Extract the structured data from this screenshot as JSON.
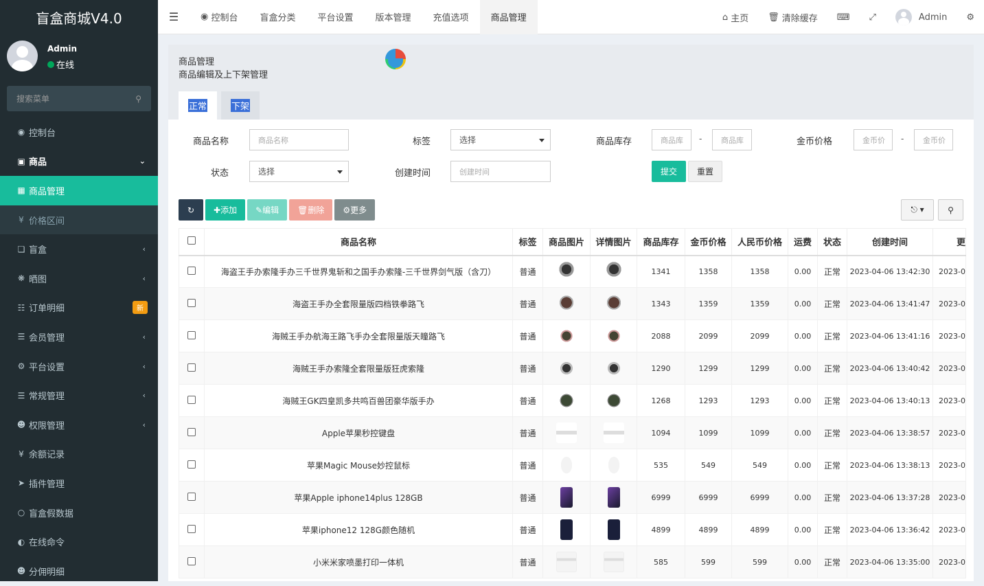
{
  "app": {
    "title": "盲盒商城V4.0"
  },
  "user": {
    "name": "Admin",
    "status": "在线"
  },
  "search": {
    "placeholder": "搜索菜单"
  },
  "menu": [
    {
      "label": "控制台",
      "icon": "dashboard-icon"
    },
    {
      "label": "商品",
      "icon": "shopping-bag-icon"
    },
    {
      "label": "商品管理",
      "icon": "shop-icon"
    },
    {
      "label": "价格区间",
      "icon": "yen-icon"
    },
    {
      "label": "盲盒",
      "icon": "cube-icon"
    },
    {
      "label": "晒图",
      "icon": "gear-icon"
    },
    {
      "label": "订单明细",
      "icon": "cart-icon",
      "badge": "新"
    },
    {
      "label": "会员管理",
      "icon": "list-icon"
    },
    {
      "label": "平台设置",
      "icon": "cog-icon"
    },
    {
      "label": "常规管理",
      "icon": "database-icon"
    },
    {
      "label": "权限管理",
      "icon": "users-icon"
    },
    {
      "label": "余额记录",
      "icon": "yen-icon"
    },
    {
      "label": "插件管理",
      "icon": "rocket-icon"
    },
    {
      "label": "盲盒假数据",
      "icon": "circle-icon"
    },
    {
      "label": "在线命令",
      "icon": "terminal-icon"
    },
    {
      "label": "分佣明细",
      "icon": "users-icon"
    }
  ],
  "topnav": {
    "tabs": [
      "控制台",
      "盲盒分类",
      "平台设置",
      "版本管理",
      "充值选项",
      "商品管理"
    ],
    "home": "主页",
    "clear_cache": "清除缓存",
    "admin": "Admin"
  },
  "panel": {
    "title": "商品管理",
    "subtitle": "商品编辑及上下架管理",
    "tab_normal": "正常",
    "tab_off": "下架"
  },
  "filter": {
    "name_label": "商品名称",
    "name_ph": "商品名称",
    "tag_label": "标签",
    "tag_value": "选择",
    "stock_label": "商品库存",
    "stock_ph": "商品库",
    "price_label": "金币价格",
    "price_ph": "金币价",
    "status_label": "状态",
    "status_value": "选择",
    "time_label": "创建时间",
    "time_ph": "创建时间",
    "submit": "提交",
    "reset": "重置",
    "dash": "-"
  },
  "toolbar": {
    "add": "添加",
    "edit": "编辑",
    "delete": "删除",
    "more": "更多"
  },
  "table": {
    "headers": [
      "商品名称",
      "标签",
      "商品图片",
      "详情图片",
      "商品库存",
      "金币价格",
      "人民币价格",
      "运费",
      "状态",
      "创建时间",
      "更"
    ],
    "rows": [
      {
        "name": "海盗王手办索隆手办三千世界鬼斩和之国手办索隆-三千世界剑气版（含刀）",
        "tag": "普通",
        "stock": "1341",
        "coin": "1358",
        "rmb": "1358",
        "fee": "0.00",
        "status": "正常",
        "created": "2023-04-06 13:42:30",
        "updated": "2023-0",
        "img": "t-fig"
      },
      {
        "name": "海盗王手办全套限量版四档铁拳路飞",
        "tag": "普通",
        "stock": "1343",
        "coin": "1359",
        "rmb": "1359",
        "fee": "0.00",
        "status": "正常",
        "created": "2023-04-06 13:41:47",
        "updated": "2023-0",
        "img": "t-fig2"
      },
      {
        "name": "海贼王手办航海王路飞手办全套限量版天瞳路飞",
        "tag": "普通",
        "stock": "2088",
        "coin": "2099",
        "rmb": "2099",
        "fee": "0.00",
        "status": "正常",
        "created": "2023-04-06 13:41:16",
        "updated": "2023-0",
        "img": "t-fig3"
      },
      {
        "name": "海贼王手办索隆全套限量版狂虎索隆",
        "tag": "普通",
        "stock": "1290",
        "coin": "1299",
        "rmb": "1299",
        "fee": "0.00",
        "status": "正常",
        "created": "2023-04-06 13:40:42",
        "updated": "2023-0",
        "img": "t-fig4"
      },
      {
        "name": "海贼王GK四皇凯多共鸣百兽团豪华版手办",
        "tag": "普通",
        "stock": "1268",
        "coin": "1293",
        "rmb": "1293",
        "fee": "0.00",
        "status": "正常",
        "created": "2023-04-06 13:40:13",
        "updated": "2023-0",
        "img": "t-fig5"
      },
      {
        "name": "Apple苹果秒控键盘",
        "tag": "普通",
        "stock": "1094",
        "coin": "1099",
        "rmb": "1099",
        "fee": "0.00",
        "status": "正常",
        "created": "2023-04-06 13:38:57",
        "updated": "2023-0",
        "img": "t-kb"
      },
      {
        "name": "苹果Magic Mouse妙控鼠标",
        "tag": "普通",
        "stock": "535",
        "coin": "549",
        "rmb": "549",
        "fee": "0.00",
        "status": "正常",
        "created": "2023-04-06 13:38:13",
        "updated": "2023-0",
        "img": "t-mouse"
      },
      {
        "name": "苹果Apple iphone14plus 128GB",
        "tag": "普通",
        "stock": "6999",
        "coin": "6999",
        "rmb": "6999",
        "fee": "0.00",
        "status": "正常",
        "created": "2023-04-06 13:37:28",
        "updated": "2023-0",
        "img": "t-ph1"
      },
      {
        "name": "苹果iphone12 128G颜色随机",
        "tag": "普通",
        "stock": "4899",
        "coin": "4899",
        "rmb": "4899",
        "fee": "0.00",
        "status": "正常",
        "created": "2023-04-06 13:36:42",
        "updated": "2023-0",
        "img": "t-ph2"
      },
      {
        "name": "小米米家喷墨打印一体机",
        "tag": "普通",
        "stock": "585",
        "coin": "599",
        "rmb": "599",
        "fee": "0.00",
        "status": "正常",
        "created": "2023-04-06 13:35:00",
        "updated": "2023-0",
        "img": "t-prn"
      }
    ]
  },
  "colors": {
    "sidebar": "#222d32",
    "accent": "#18bc9c",
    "badge": "#f39c12",
    "dark_btn": "#2c3e50",
    "delete": "#e74c3c"
  }
}
